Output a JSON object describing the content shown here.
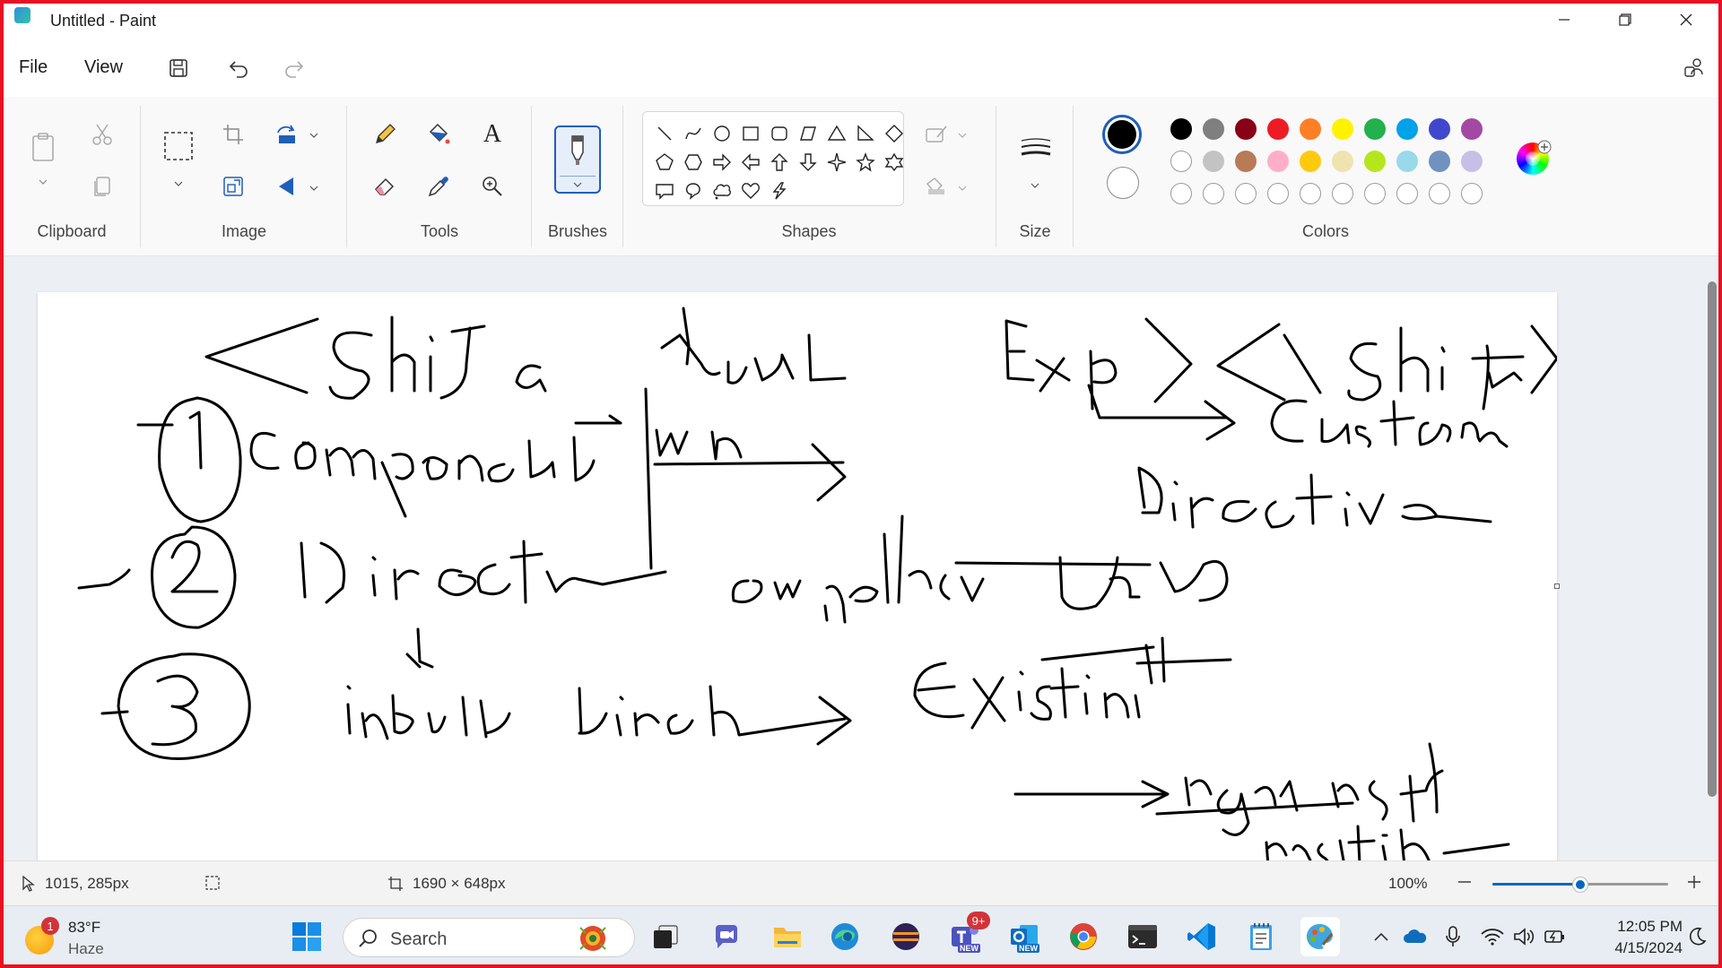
{
  "window": {
    "title": "Untitled - Paint",
    "controls": {
      "minimize": "minimize-icon",
      "restore": "restore-icon",
      "close": "close-icon"
    }
  },
  "menu": {
    "file": "File",
    "view": "View",
    "icons": [
      "save-icon",
      "undo-icon",
      "redo-icon",
      "account-icon"
    ]
  },
  "ribbon": {
    "groups": {
      "clipboard": "Clipboard",
      "image": "Image",
      "tools": "Tools",
      "brushes": "Brushes",
      "shapes": "Shapes",
      "size": "Size",
      "colors": "Colors"
    },
    "text_tool_glyph": "A",
    "shapes": [
      "line",
      "curve",
      "oval",
      "rectangle",
      "rounded-rectangle",
      "polygon",
      "triangle",
      "right-triangle",
      "diamond",
      "pentagon",
      "hexagon",
      "right-arrow",
      "left-arrow",
      "up-arrow",
      "down-arrow",
      "four-point-star",
      "five-point-star",
      "six-point-star",
      "rectangular-callout",
      "oval-callout",
      "cloud-callout",
      "heart",
      "lightning"
    ],
    "colors": {
      "primary": "#000000",
      "secondary": "#ffffff",
      "row1": [
        "#000000",
        "#7f7f7f",
        "#880015",
        "#ed1c24",
        "#ff7f27",
        "#fff200",
        "#22b14c",
        "#00a2e8",
        "#3f48cc",
        "#a349a4"
      ],
      "row2": [
        "#ffffff",
        "#c3c3c3",
        "#b97a57",
        "#ffaec9",
        "#ffc90e",
        "#efe4b0",
        "#b5e61d",
        "#99d9ea",
        "#7092be",
        "#c8bfe7"
      ],
      "row3_empty_count": 10
    }
  },
  "status": {
    "cursor_position": "1015, 285px",
    "canvas_size": "1690 × 648px",
    "zoom": "100%",
    "zoom_level": 0.5
  },
  "taskbar": {
    "weather": {
      "temp": "83°F",
      "condition": "Haze",
      "badge": "1"
    },
    "search_placeholder": "Search",
    "teams_badge": "9+",
    "new_label": "NEW",
    "time": "12:05 PM",
    "date": "4/15/2024",
    "apps": [
      "start",
      "search",
      "widgets-art",
      "task-view",
      "chat",
      "file-explorer",
      "edge",
      "eclipse",
      "teams",
      "outlook",
      "chrome",
      "terminal",
      "vscode",
      "notepad",
      "paint"
    ]
  }
}
